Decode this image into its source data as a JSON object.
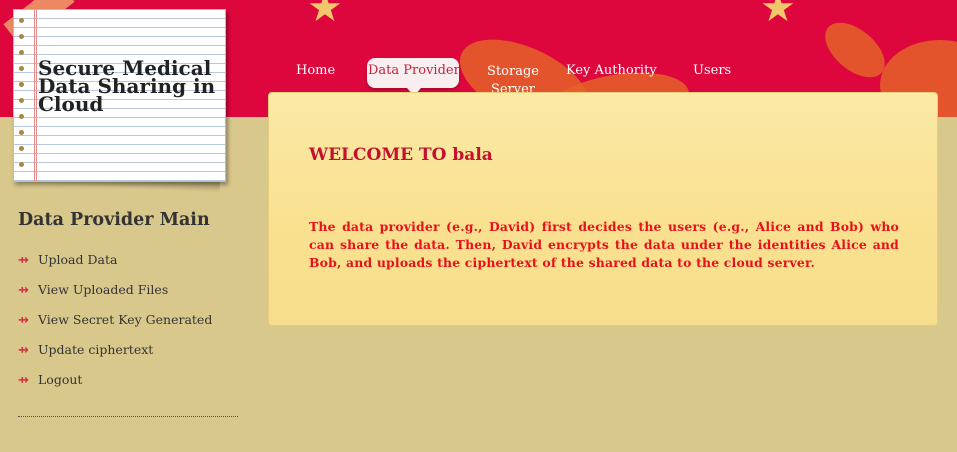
{
  "logo": {
    "title": "Secure Medical Data Sharing in Cloud"
  },
  "nav": {
    "items": [
      {
        "label": "Home",
        "active": false
      },
      {
        "label": "Data Provider",
        "active": true
      },
      {
        "label": "Storage Server",
        "active": false
      },
      {
        "label": "Key Authority",
        "active": false
      },
      {
        "label": "Users",
        "active": false
      }
    ]
  },
  "content": {
    "welcome": "WELCOME TO bala",
    "description": "The data provider (e.g., David) first decides the users (e.g., Alice and Bob) who can share the data. Then, David encrypts the data under the identities Alice and Bob, and uploads the ciphertext of the shared data to the cloud server."
  },
  "sidebar": {
    "title": "Data Provider Main",
    "items": [
      {
        "label": "Upload Data",
        "icon": "arrow-bullet-icon"
      },
      {
        "label": "View Uploaded Files",
        "icon": "arrow-bullet-icon"
      },
      {
        "label": "View Secret Key Generated",
        "icon": "arrow-bullet-icon"
      },
      {
        "label": "Update ciphertext",
        "icon": "arrow-bullet-icon"
      },
      {
        "label": "Logout",
        "icon": "arrow-bullet-icon"
      }
    ]
  },
  "colors": {
    "header": "#dd073d",
    "background": "#d9c88c",
    "accent_text": "#e8101a"
  }
}
